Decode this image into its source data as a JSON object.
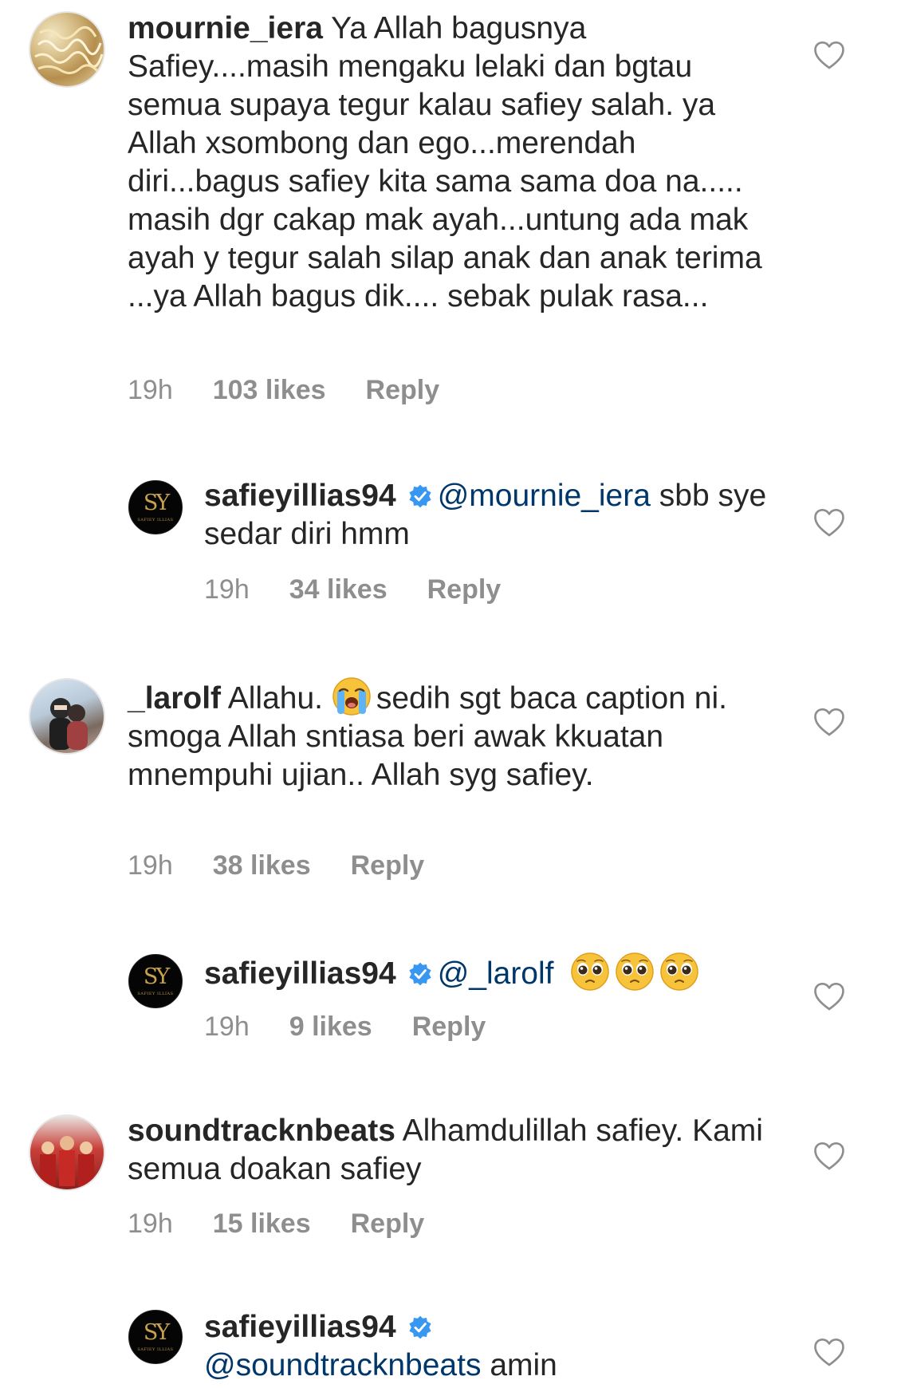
{
  "comments": [
    {
      "username": "mournie_iera",
      "text": "Ya Allah bagusnya Safiey....masih mengaku lelaki dan bgtau semua supaya tegur kalau safiey salah. ya Allah xsombong dan ego...merendah diri...bagus safiey kita sama sama doa na..... masih dgr cakap mak ayah...untung ada mak ayah y tegur salah silap anak dan anak terima ...ya Allah bagus dik.... sebak pulak rasa...",
      "time": "19h",
      "likes": "103 likes",
      "reply_label": "Reply",
      "avatar_icon": "noodle-photo-avatar"
    },
    {
      "username": "safieyillias94",
      "verified": true,
      "mention": "@mournie_iera",
      "text": "sbb sye sedar diri hmm",
      "time": "19h",
      "likes": "34 likes",
      "reply_label": "Reply",
      "avatar_text": "SY",
      "avatar_subtext": "SAFIEY ILLIAS"
    },
    {
      "username": "_larolf",
      "text_before": "Allahu.",
      "emoji": "loudly-crying-face",
      "text": "sedih sgt baca caption ni. smoga Allah sntiasa beri awak kkuatan mnempuhi ujian.. Allah syg safiey.",
      "time": "19h",
      "likes": "38 likes",
      "reply_label": "Reply",
      "avatar_icon": "couple-photo-avatar"
    },
    {
      "username": "safieyillias94",
      "verified": true,
      "mention": "@_larolf",
      "emojis": [
        "pleading-face",
        "pleading-face",
        "pleading-face"
      ],
      "time": "19h",
      "likes": "9 likes",
      "reply_label": "Reply",
      "avatar_text": "SY",
      "avatar_subtext": "SAFIEY ILLIAS"
    },
    {
      "username": "soundtracknbeats",
      "text": "Alhamdulillah safiey. Kami semua doakan safiey",
      "time": "19h",
      "likes": "15 likes",
      "reply_label": "Reply",
      "avatar_icon": "team-photo-avatar"
    },
    {
      "username": "safieyillias94",
      "verified": true,
      "mention": "@soundtracknbeats",
      "text": "amin",
      "avatar_text": "SY",
      "avatar_subtext": "SAFIEY ILLIAS"
    }
  ],
  "colors": {
    "text": "#262626",
    "meta": "#8e8e8e",
    "mention": "#00376b",
    "verified": "#3897f0",
    "heart_outline": "#8e8e8e"
  }
}
